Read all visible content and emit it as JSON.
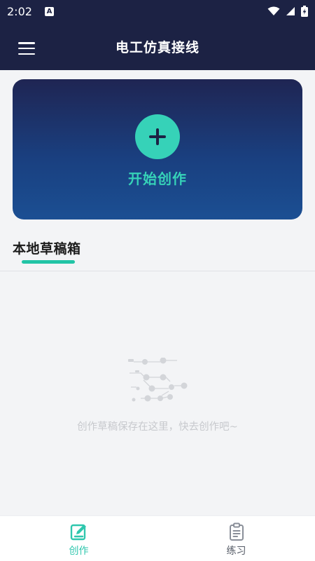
{
  "status_bar": {
    "time": "2:02",
    "notification_letter": "A",
    "icons": [
      "wifi-icon",
      "signal-icon",
      "battery-charging-icon"
    ]
  },
  "app_bar": {
    "title": "电工仿真接线",
    "menu_icon": "menu-icon"
  },
  "hero": {
    "label": "开始创作",
    "icon": "plus-icon",
    "accent_color": "#36d2b8"
  },
  "section": {
    "title": "本地草稿箱",
    "indicator_color": "#22c4a6"
  },
  "empty_state": {
    "illustration_icon": "circuit-nodes-icon",
    "message": "创作草稿保存在这里，快去创作吧~"
  },
  "bottom_nav": {
    "items": [
      {
        "label": "创作",
        "icon": "edit-icon",
        "active": true
      },
      {
        "label": "练习",
        "icon": "clipboard-icon",
        "active": false
      }
    ],
    "active_color": "#2fc7ae",
    "inactive_color": "#555b66"
  },
  "colors": {
    "header_bg": "#1c2244",
    "page_bg": "#f3f4f6"
  }
}
